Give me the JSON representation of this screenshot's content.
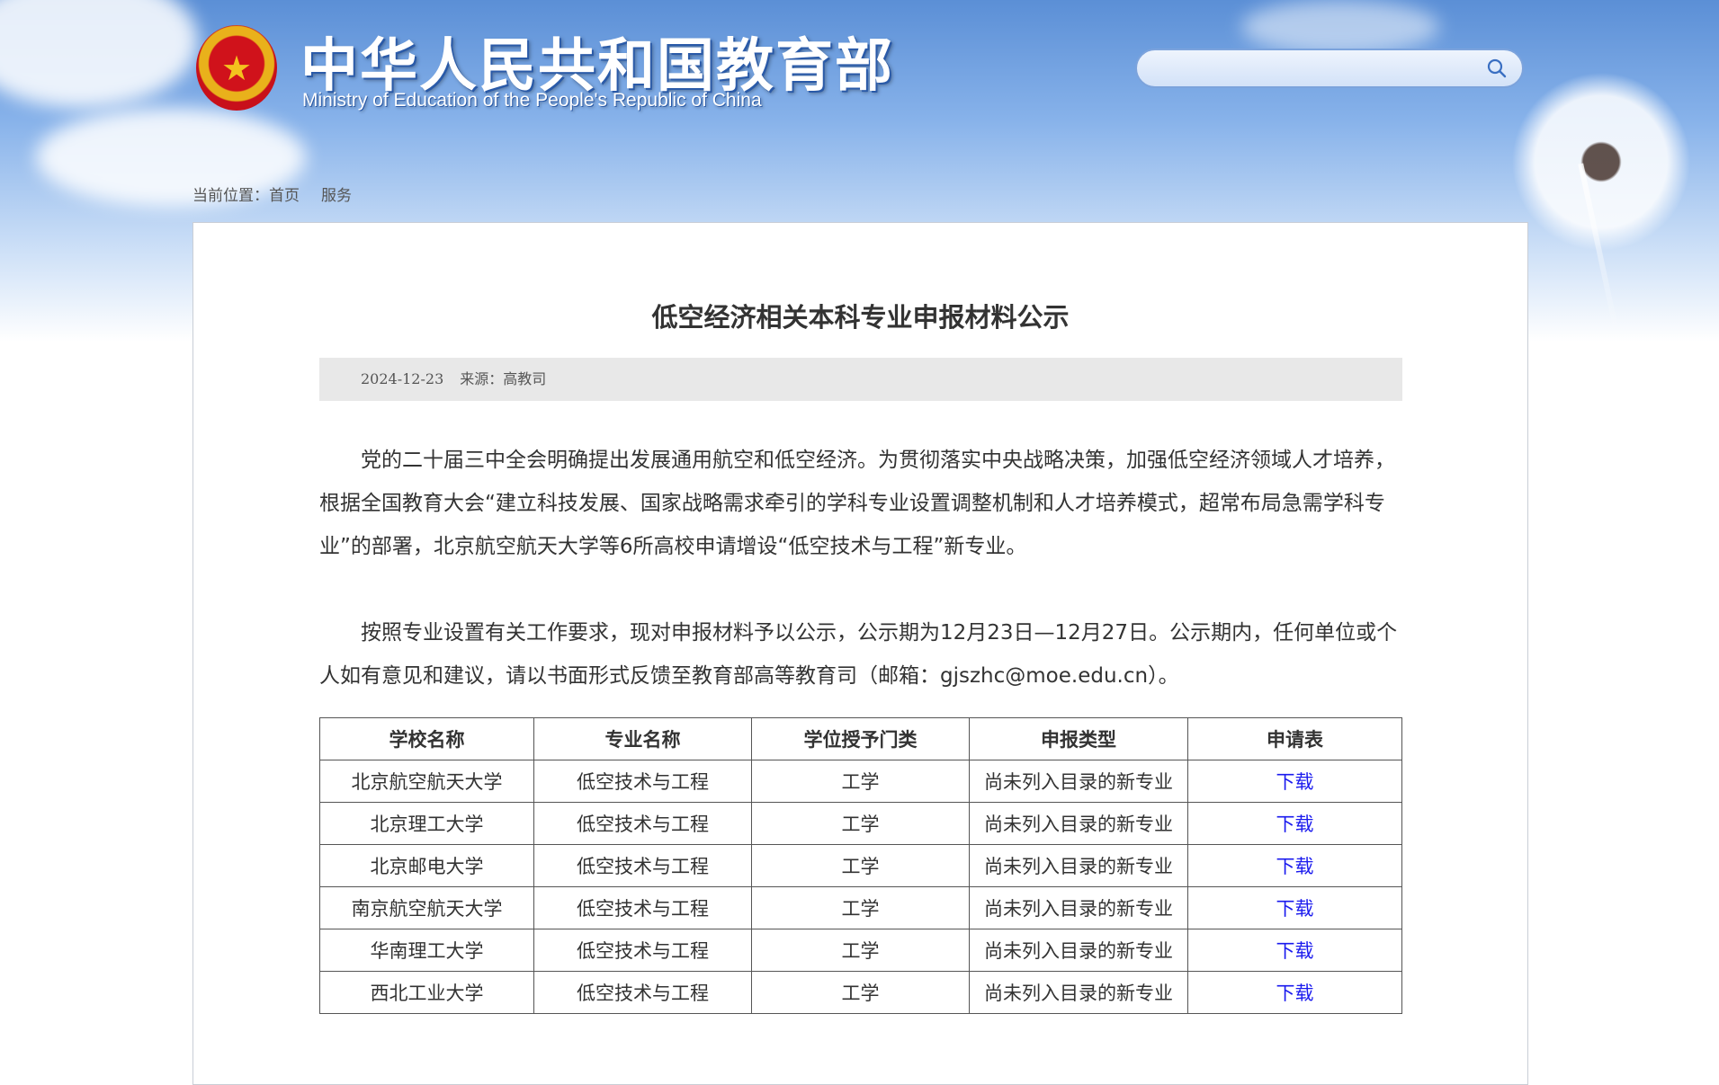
{
  "header": {
    "logo_cn": "中华人民共和国教育部",
    "logo_en": "Ministry of Education of the People's Republic of China",
    "emblem_icon": "national-emblem-icon",
    "search": {
      "placeholder": "",
      "value": "",
      "icon": "search-icon"
    }
  },
  "breadcrumb": {
    "label": "当前位置：",
    "items": [
      "首页",
      "服务"
    ]
  },
  "article": {
    "title": "低空经济相关本科专业申报材料公示",
    "date": "2024-12-23",
    "source": "来源：高教司",
    "paragraphs": [
      "党的二十届三中全会明确提出发展通用航空和低空经济。为贯彻落实中央战略决策，加强低空经济领域人才培养，根据全国教育大会“建立科技发展、国家战略需求牵引的学科专业设置调整机制和人才培养模式，超常布局急需学科专业”的部署，北京航空航天大学等6所高校申请增设“低空技术与工程”新专业。",
      "按照专业设置有关工作要求，现对申报材料予以公示，公示期为12月23日—12月27日。公示期内，任何单位或个人如有意见和建议，请以书面形式反馈至教育部高等教育司（邮箱：gjszhc@moe.edu.cn）。"
    ]
  },
  "table": {
    "headers": [
      "学校名称",
      "专业名称",
      "学位授予门类",
      "申报类型",
      "申请表"
    ],
    "rows": [
      [
        "北京航空航天大学",
        "低空技术与工程",
        "工学",
        "尚未列入目录的新专业",
        "下载"
      ],
      [
        "北京理工大学",
        "低空技术与工程",
        "工学",
        "尚未列入目录的新专业",
        "下载"
      ],
      [
        "北京邮电大学",
        "低空技术与工程",
        "工学",
        "尚未列入目录的新专业",
        "下载"
      ],
      [
        "南京航空航天大学",
        "低空技术与工程",
        "工学",
        "尚未列入目录的新专业",
        "下载"
      ],
      [
        "华南理工大学",
        "低空技术与工程",
        "工学",
        "尚未列入目录的新专业",
        "下载"
      ],
      [
        "西北工业大学",
        "低空技术与工程",
        "工学",
        "尚未列入目录的新专业",
        "下载"
      ]
    ]
  },
  "colors": {
    "link": "#1a1aee",
    "sky_top": "#5b8fd6",
    "meta_bg": "#e8e8e8"
  }
}
